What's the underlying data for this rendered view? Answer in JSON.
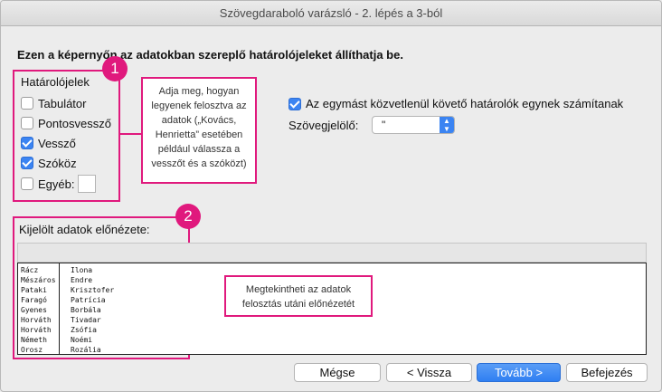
{
  "window": {
    "title": "Szövegdaraboló varázsló - 2. lépés a 3-ból"
  },
  "heading": "Ezen a képernyőn az adatokban szereplő határolójeleket állíthatja be.",
  "delimiters": {
    "title": "Határolójelek",
    "items": [
      {
        "label": "Tabulátor",
        "checked": false
      },
      {
        "label": "Pontosvessző",
        "checked": false
      },
      {
        "label": "Vessző",
        "checked": true
      },
      {
        "label": "Szóköz",
        "checked": true
      },
      {
        "label": "Egyéb:",
        "checked": false,
        "value": ""
      }
    ]
  },
  "callouts": [
    {
      "number": "1",
      "text": "Adja meg, hogyan legyenek felosztva az adatok („Kovács, Henrietta” esetében például válassza a vesszőt és a szóközt)"
    },
    {
      "number": "2",
      "text": "Megtekintheti az adatok felosztás utáni előnézetét"
    }
  ],
  "options": {
    "consecutive_label": "Az egymást közvetlenül követő határolók egynek számítanak",
    "consecutive_checked": true,
    "qualifier_label": "Szövegjelölő:",
    "qualifier_value": "\""
  },
  "preview": {
    "label": "Kijelölt adatok előnézete:",
    "rows": [
      [
        "Rácz",
        "Ilona"
      ],
      [
        "Mészáros",
        "Endre"
      ],
      [
        "Pataki",
        "Krisztofer"
      ],
      [
        "Faragó",
        "Patrícia"
      ],
      [
        "Gyenes",
        "Borbála"
      ],
      [
        "Horváth",
        "Tivadar"
      ],
      [
        "Horváth",
        "Zsófia"
      ],
      [
        "Németh",
        "Noémi"
      ],
      [
        "Orosz",
        "Rozália"
      ]
    ]
  },
  "buttons": {
    "cancel": "Mégse",
    "back": "< Vissza",
    "next": "Tovább >",
    "finish": "Befejezés"
  },
  "colors": {
    "accent": "#e0197d",
    "checkbox_blue": "#3b84f2"
  },
  "icons": {
    "select_arrow": "chevron-updown-icon",
    "checkmark": "checkmark-icon"
  }
}
